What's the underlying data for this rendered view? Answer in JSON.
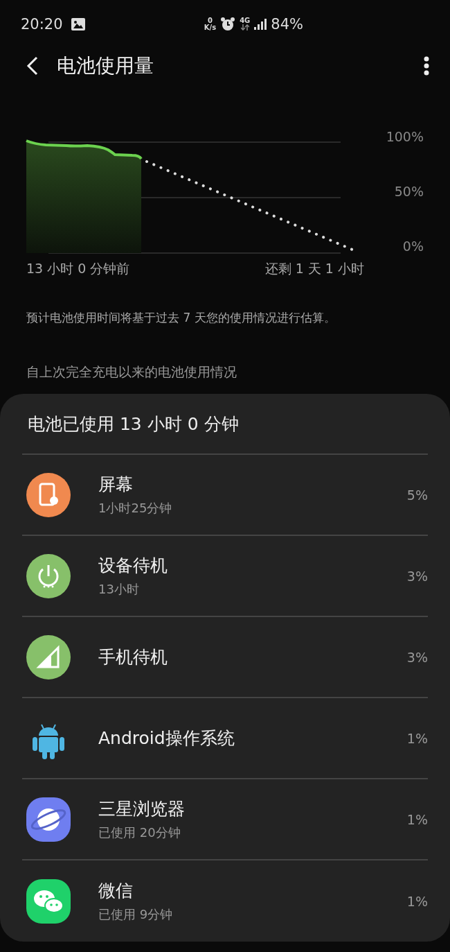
{
  "status_bar": {
    "time": "20:20",
    "net_speed_value": "0",
    "net_speed_unit": "K/s",
    "network": "4G",
    "battery": "84%"
  },
  "header": {
    "title": "电池使用量"
  },
  "graph": {
    "y_labels": [
      "100%",
      "50%",
      "0%"
    ],
    "start_label": "13 小时 0 分钟前",
    "end_label": "还剩 1 天 1 小时"
  },
  "note": "预计电池使用时间将基于过去 7 天您的使用情况进行估算。",
  "section_title": "自上次完全充电以来的电池使用情况",
  "usage_card": {
    "title": "电池已使用 13 小时 0 分钟",
    "items": [
      {
        "kind": "screen",
        "name": "屏幕",
        "detail": "1小时25分钟",
        "percent": "5%"
      },
      {
        "kind": "idle",
        "name": "设备待机",
        "detail": "13小时",
        "percent": "3%"
      },
      {
        "kind": "cell",
        "name": "手机待机",
        "percent": "3%"
      },
      {
        "kind": "android",
        "name": "Android操作系统",
        "percent": "1%"
      },
      {
        "kind": "browser",
        "name": "三星浏览器",
        "detail": "已使用 20分钟",
        "percent": "1%"
      },
      {
        "kind": "chat",
        "name": "微信",
        "detail": "已使用 9分钟",
        "percent": "1%"
      }
    ]
  }
}
